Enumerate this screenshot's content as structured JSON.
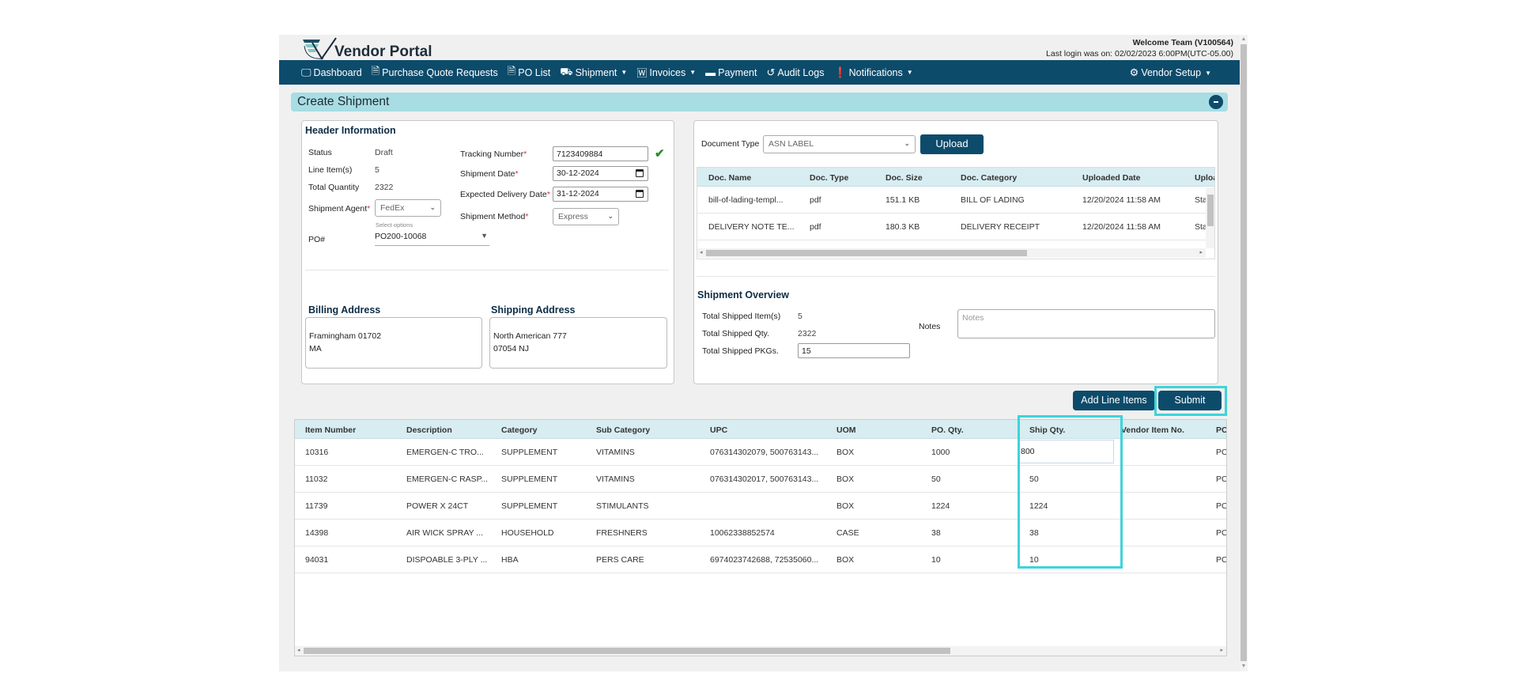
{
  "app": {
    "title": "Vendor Portal",
    "welcome": "Welcome  Team (V100564)",
    "last_login": "Last login was on: 02/02/2023 6:00PM(UTC-05.00)"
  },
  "nav": {
    "items": [
      {
        "label": "Dashboard",
        "icon": "monitor-icon",
        "glyph": "🖵"
      },
      {
        "label": "Purchase Quote Requests",
        "icon": "document-icon",
        "glyph": "🗎"
      },
      {
        "label": "PO List",
        "icon": "document-icon",
        "glyph": "🗎"
      },
      {
        "label": "Shipment",
        "icon": "truck-icon",
        "glyph": "⛟",
        "dropdown": true
      },
      {
        "label": "Invoices",
        "icon": "word-document-icon",
        "glyph": "🅆",
        "dropdown": true
      },
      {
        "label": "Payment",
        "icon": "credit-card-icon",
        "glyph": "▬"
      },
      {
        "label": "Audit Logs",
        "icon": "history-icon",
        "glyph": "↺"
      },
      {
        "label": "Notifications",
        "icon": "alert-circle-icon",
        "glyph": "❗",
        "dropdown": true
      }
    ],
    "right": {
      "label": "Vendor Setup",
      "icon": "gear-icon",
      "glyph": "⚙",
      "dropdown": true
    },
    "caret": "▼"
  },
  "panel": {
    "title": "Create Shipment",
    "collapse_icon": "minus-icon"
  },
  "header_info": {
    "title": "Header Information",
    "status_label": "Status",
    "status_value": "Draft",
    "line_items_label": "Line Item(s)",
    "line_items_value": "5",
    "total_qty_label": "Total Quantity",
    "total_qty_value": "2322",
    "agent_label": "Shipment Agent",
    "agent_value": "FedEx",
    "agent_hint": "Select options",
    "po_label": "PO#",
    "po_value": "PO200-10068",
    "tracking_label": "Tracking Number",
    "tracking_value": "7123409884",
    "ship_date_label": "Shipment Date",
    "ship_date_value": "30-12-2024",
    "delivery_label": "Expected Delivery Date",
    "delivery_value": "31-12-2024",
    "method_label": "Shipment Method",
    "method_value": "Express",
    "required_mark": "*",
    "check": "✔"
  },
  "addresses": {
    "billing_title": "Billing Address",
    "billing_line1": "Framingham 01702",
    "billing_line2": "MA",
    "shipping_title": "Shipping Address",
    "shipping_line1": "North American 777",
    "shipping_line2": "07054 NJ"
  },
  "documents": {
    "type_label": "Document Type",
    "type_value": "ASN LABEL",
    "upload_label": "Upload",
    "columns": [
      "Doc. Name",
      "Doc. Type",
      "Doc. Size",
      "Doc. Category",
      "Uploaded Date",
      "Upload"
    ],
    "rows": [
      [
        "bill-of-lading-templ...",
        "pdf",
        "151.1 KB",
        "BILL OF LADING",
        "12/20/2024 11:58 AM",
        "Stap"
      ],
      [
        "DELIVERY NOTE TE...",
        "pdf",
        "180.3 KB",
        "DELIVERY RECEIPT",
        "12/20/2024 11:58 AM",
        "Stap"
      ]
    ]
  },
  "overview": {
    "title": "Shipment Overview",
    "items_label": "Total Shipped Item(s)",
    "items_value": "5",
    "qty_label": "Total Shipped Qty.",
    "qty_value": "2322",
    "pkgs_label": "Total Shipped PKGs.",
    "pkgs_value": "15",
    "notes_label": "Notes",
    "notes_placeholder": "Notes"
  },
  "actions": {
    "add_line_items": "Add Line Items",
    "submit": "Submit"
  },
  "line_items": {
    "columns": [
      "Item Number",
      "Description",
      "Category",
      "Sub Category",
      "UPC",
      "UOM",
      "PO. Qty.",
      "Ship Qty.",
      "Vendor Item No.",
      "PC"
    ],
    "rows": [
      [
        "10316",
        "EMERGEN-C TRO...",
        "SUPPLEMENT",
        "VITAMINS",
        "076314302079, 500763143...",
        "BOX",
        "1000",
        "800",
        "",
        "PC"
      ],
      [
        "11032",
        "EMERGEN-C RASP...",
        "SUPPLEMENT",
        "VITAMINS",
        "076314302017, 500763143...",
        "BOX",
        "50",
        "50",
        "",
        "PC"
      ],
      [
        "11739",
        "POWER X 24CT",
        "SUPPLEMENT",
        "STIMULANTS",
        "",
        "BOX",
        "1224",
        "1224",
        "",
        "PC"
      ],
      [
        "14398",
        "AIR WICK SPRAY ...",
        "HOUSEHOLD",
        "FRESHNERS",
        "10062338852574",
        "CASE",
        "38",
        "38",
        "",
        "PC"
      ],
      [
        "94031",
        "DISPOABLE 3-PLY ...",
        "HBA",
        "PERS CARE",
        "6974023742688, 72535060...",
        "BOX",
        "10",
        "10",
        "",
        "PC"
      ]
    ]
  },
  "colors": {
    "primary": "#0d4b6b",
    "panel_header": "#a8dde3",
    "grid_header": "#d7edf1",
    "highlight": "#3fd3da",
    "check": "#2e8b2e"
  }
}
